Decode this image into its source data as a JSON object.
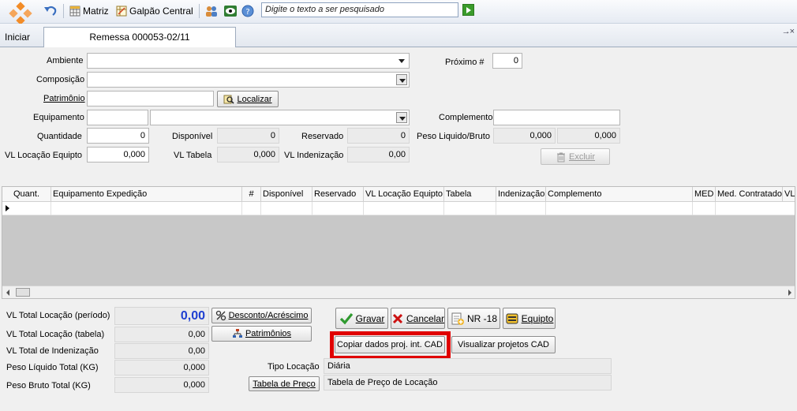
{
  "toolbar": {
    "matriz_label": "Matriz",
    "galpao_label": "Galpão Central",
    "search_placeholder": "Digite o texto a ser pesquisado"
  },
  "tabs": {
    "home_label": "Iniciar",
    "active_label": "Remessa 000053-02/11",
    "close_label": "→×"
  },
  "form": {
    "ambiente_label": "Ambiente",
    "composicao_label": "Composição",
    "patrimonio_label": "Patrimônio",
    "localizar_label": "Localizar",
    "equipamento_label": "Equipamento",
    "quantidade_label": "Quantidade",
    "quantidade_value": "0",
    "disponivel_label": "Disponível",
    "disponivel_value": "0",
    "reservado_label": "Reservado",
    "reservado_value": "0",
    "vl_locacao_label": "VL Locação Equipto",
    "vl_locacao_value": "0,000",
    "vl_tabela_label": "VL Tabela",
    "vl_tabela_value": "0,000",
    "vl_indenizacao_label": "VL Indenização",
    "vl_indenizacao_value": "0,00",
    "proximo_label": "Próximo #",
    "proximo_value": "0",
    "complemento_label": "Complemento",
    "peso_label": "Peso Liquido/Bruto",
    "peso_liquido_value": "0,000",
    "peso_bruto_value": "0,000",
    "excluir_label": "Excluir"
  },
  "grid": {
    "columns": [
      "Quant.",
      "Equipamento Expedição",
      "#",
      "Disponível",
      "Reservado",
      "VL Locação Equipto",
      "Tabela",
      "Indenização",
      "Complemento",
      "MED",
      "Med. Contratado",
      "VL"
    ]
  },
  "totals": {
    "total_periodo_label": "VL Total Locação (período)",
    "total_periodo_value": "0,00",
    "total_tabela_label": "VL Total Locação (tabela)",
    "total_tabela_value": "0,00",
    "total_indenizacao_label": "VL Total de Indenização",
    "total_indenizacao_value": "0,00",
    "peso_liquido_label": "Peso Líquido Total (KG)",
    "peso_liquido_value": "0,000",
    "peso_bruto_label": "Peso Bruto Total (KG)",
    "peso_bruto_value": "0,000"
  },
  "actions": {
    "desconto_label": "Desconto/Acréscimo",
    "patrimonios_label": "Patrimônios",
    "gravar_label": "Gravar",
    "cancelar_label": "Cancelar",
    "nr18_label": "NR -18",
    "equipto_label": "Equipto",
    "copiar_label": "Copiar dados proj. int. CAD",
    "visualizar_label": "Visualizar projetos CAD",
    "tabela_preco_label": "Tabela de Preço"
  },
  "bottom": {
    "tipo_locacao_label": "Tipo Locação",
    "tipo_locacao_value": "Diária",
    "tabela_preco_value": "Tabela de Preço de Locação"
  },
  "colors": {
    "accent_blue": "#1f3fd1",
    "highlight_red": "#e00000",
    "gravar_green": "#2f9a2f",
    "cancelar_red": "#cc1111"
  }
}
